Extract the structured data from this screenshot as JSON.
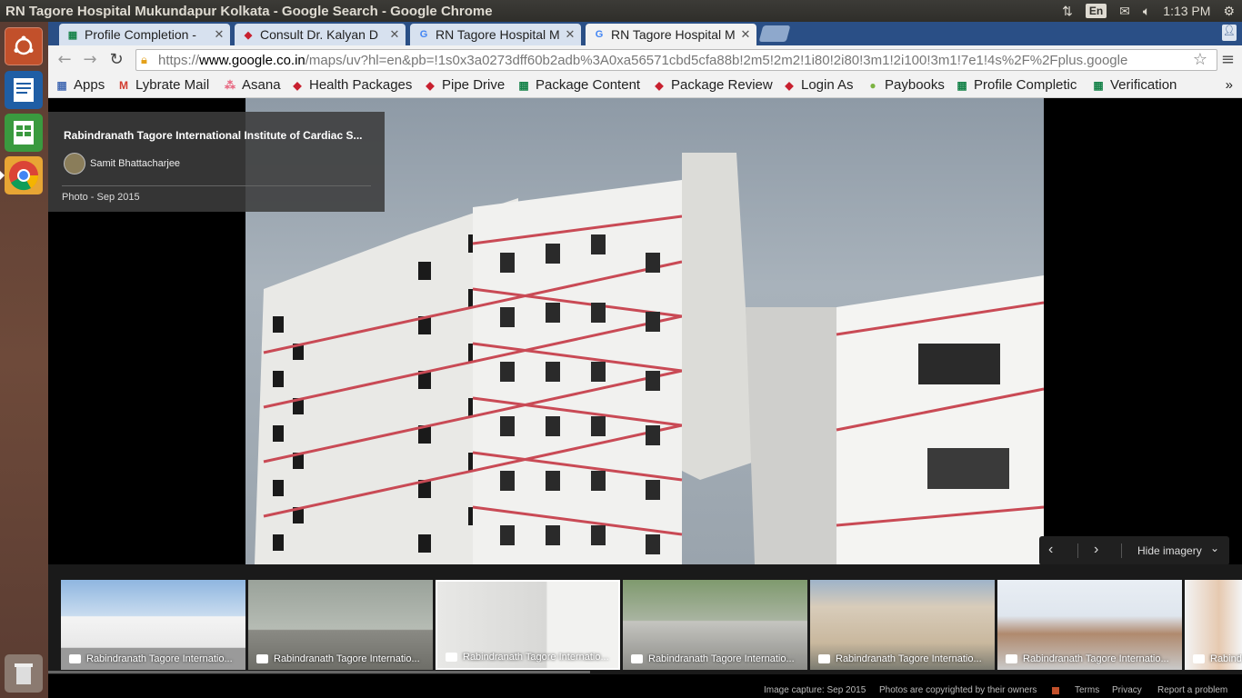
{
  "window": {
    "title": "RN Tagore Hospital Mukundapur Kolkata - Google Search - Google Chrome"
  },
  "indicators": {
    "keyboard": "En",
    "time": "1:13 PM"
  },
  "tabs": [
    {
      "label": "Profile Completion -",
      "favicon": "sheets-icon",
      "active": false
    },
    {
      "label": "Consult Dr. Kalyan D",
      "favicon": "lybrate-icon",
      "active": false
    },
    {
      "label": "RN Tagore Hospital M",
      "favicon": "google-icon",
      "active": false
    },
    {
      "label": "RN Tagore Hospital M",
      "favicon": "google-icon",
      "active": true
    }
  ],
  "omnibox": {
    "scheme": "https://",
    "host": "www.google.co.in",
    "path": "/maps/uv?hl=en&pb=!1s0x3a0273dff60b2adb%3A0xa56571cbd5cfa88b!2m5!2m2!1i80!2i80!3m1!2i100!3m1!7e1!4s%2F%2Fplus.google"
  },
  "bookmarks": [
    {
      "label": "Apps",
      "icon": "apps-grid-icon"
    },
    {
      "label": "Lybrate Mail",
      "icon": "gmail-icon"
    },
    {
      "label": "Asana",
      "icon": "asana-icon"
    },
    {
      "label": "Health Packages",
      "icon": "lybrate-icon"
    },
    {
      "label": "Pipe Drive",
      "icon": "lybrate-icon"
    },
    {
      "label": "Package Content",
      "icon": "sheets-icon"
    },
    {
      "label": "Package Review",
      "icon": "lybrate-icon"
    },
    {
      "label": "Login As",
      "icon": "lybrate-icon"
    },
    {
      "label": "Paybooks",
      "icon": "paybooks-icon"
    },
    {
      "label": "Profile Completic",
      "icon": "sheets-icon"
    },
    {
      "label": "Verification",
      "icon": "sheets-icon"
    }
  ],
  "bookmarks_more": "»",
  "info_card": {
    "title": "Rabindranath Tagore International Institute of Cardiac S...",
    "author": "Samit Bhattacharjee",
    "photo_date": "Photo - Sep 2015"
  },
  "carousel": {
    "hide_label": "Hide imagery"
  },
  "thumbnails": [
    {
      "caption": "Rabindranath Tagore Internatio...",
      "active": false
    },
    {
      "caption": "Rabindranath Tagore Internatio...",
      "active": false
    },
    {
      "caption": "Rabindranath Tagore Internatio...",
      "active": true
    },
    {
      "caption": "Rabindranath Tagore Internatio...",
      "active": false
    },
    {
      "caption": "Rabindranath Tagore Internatio...",
      "active": false
    },
    {
      "caption": "Rabindranath Tagore Internatio...",
      "active": false
    },
    {
      "caption": "Rabind",
      "active": false
    }
  ],
  "footer": {
    "image_capture": "Image capture: Sep 2015",
    "copyright": "Photos are copyrighted by their owners",
    "terms": "Terms",
    "privacy": "Privacy",
    "report": "Report a problem"
  }
}
